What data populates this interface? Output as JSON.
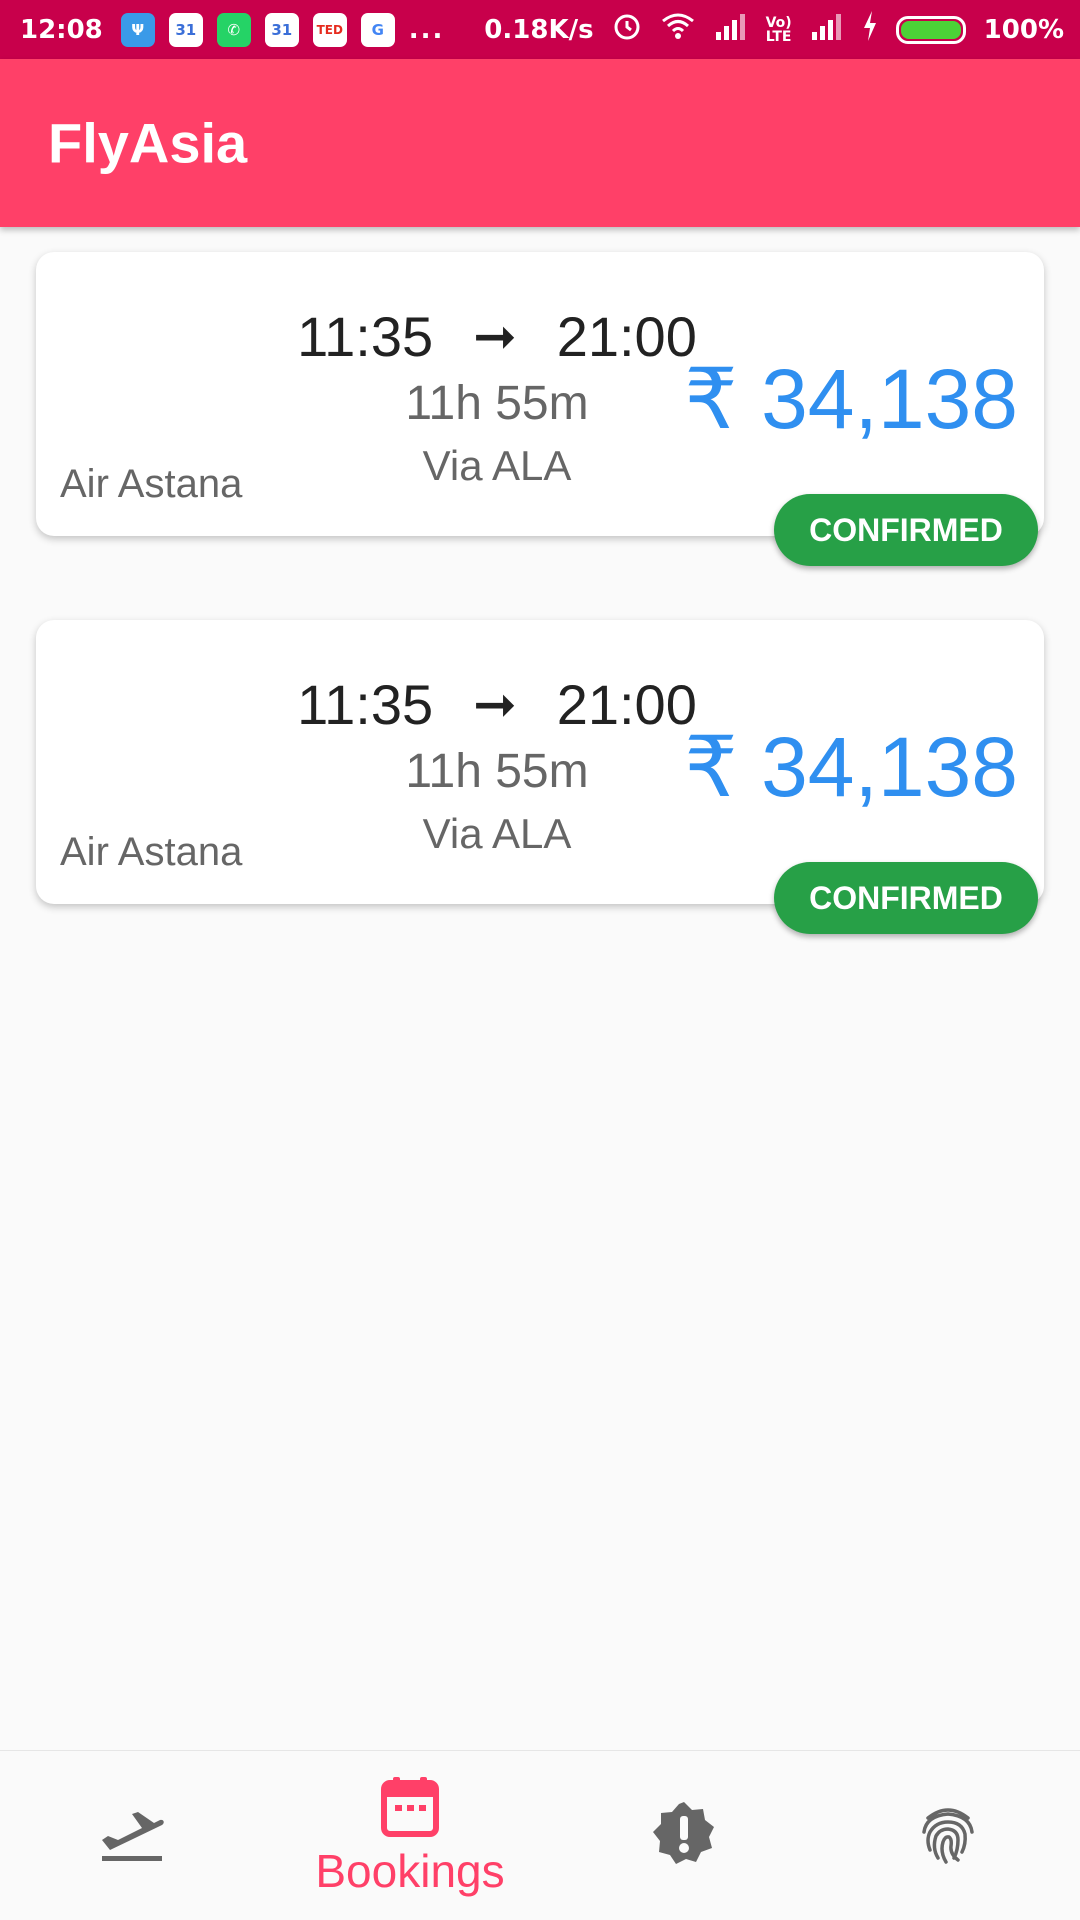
{
  "status_bar": {
    "time": "12:08",
    "more": "...",
    "net_speed": "0.18K/s",
    "battery": "100%",
    "battery_level": 1.0,
    "app_icons": [
      "usb-icon",
      "calendar-icon",
      "whatsapp-icon",
      "calendar-icon",
      "ted-icon",
      "google-icon"
    ]
  },
  "app": {
    "title": "FlyAsia",
    "bar_color": "#ff4068"
  },
  "bookings": [
    {
      "depart": "11:35",
      "arrive": "21:00",
      "duration": "11h 55m",
      "via": "Via ALA",
      "airline": "Air Astana",
      "price": "₹ 34,138",
      "status": "CONFIRMED"
    },
    {
      "depart": "11:35",
      "arrive": "21:00",
      "duration": "11h 55m",
      "via": "Via ALA",
      "airline": "Air Astana",
      "price": "₹ 34,138",
      "status": "CONFIRMED"
    }
  ],
  "colors": {
    "accent": "#ff4068",
    "status_bar": "#c8004b",
    "price": "#2f8ff0",
    "confirmed": "#27a047"
  },
  "bottom_nav": {
    "active": "Bookings",
    "items": [
      {
        "icon": "flight-takeoff-icon",
        "label": ""
      },
      {
        "icon": "calendar-icon",
        "label": "Bookings"
      },
      {
        "icon": "alert-badge-icon",
        "label": ""
      },
      {
        "icon": "fingerprint-icon",
        "label": ""
      }
    ]
  }
}
